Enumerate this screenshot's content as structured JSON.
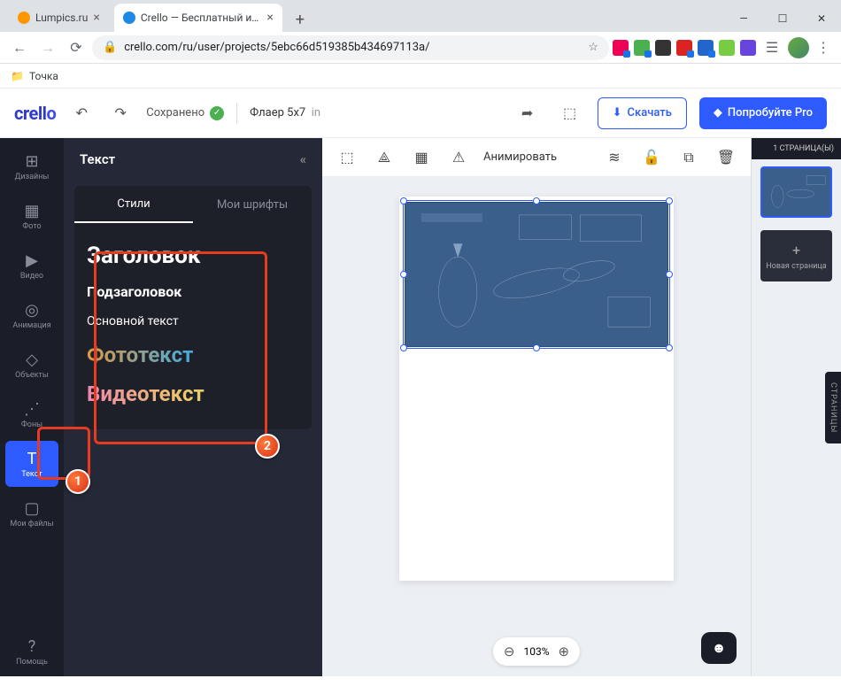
{
  "browser": {
    "tabs": [
      {
        "title": "Lumpics.ru",
        "favicon": "#ff9800"
      },
      {
        "title": "Crello — Бесплатный инструмен",
        "favicon": "#1e88e5"
      }
    ],
    "url": "crello.com/ru/user/projects/5ebc66d519385b434697113a/",
    "bookmark": "Точка"
  },
  "header": {
    "logo": "crello",
    "saved": "Сохранено",
    "projectName": "Флаер 5x7",
    "projectUnit": "in",
    "download": "Скачать",
    "tryPro": "Попробуйте Pro"
  },
  "rail": {
    "items": [
      {
        "label": "Дизайны",
        "icon": "⊞"
      },
      {
        "label": "Фото",
        "icon": "▦"
      },
      {
        "label": "Видео",
        "icon": "▶"
      },
      {
        "label": "Анимация",
        "icon": "◎"
      },
      {
        "label": "Объекты",
        "icon": "◇"
      },
      {
        "label": "Фоны",
        "icon": "⋰"
      },
      {
        "label": "Текст",
        "icon": "T"
      },
      {
        "label": "Мои файлы",
        "icon": "▢"
      }
    ],
    "help": "Помощь"
  },
  "panel": {
    "title": "Текст",
    "tabs": {
      "styles": "Стили",
      "fonts": "Мои шрифты"
    },
    "textOptions": {
      "heading": "Заголовок",
      "subheading": "Подзаголовок",
      "body": "Основной текст",
      "photo": "Фототекст",
      "video": "Видеотекст"
    }
  },
  "canvasTools": {
    "animate": "Анимировать"
  },
  "zoom": {
    "level": "103%"
  },
  "pages": {
    "header": "1 СТРАНИЦА(Ы)",
    "addPage": "Новая страница",
    "sideTab": "СТРАНИЦЫ"
  },
  "annotations": {
    "a1": "1",
    "a2": "2"
  }
}
